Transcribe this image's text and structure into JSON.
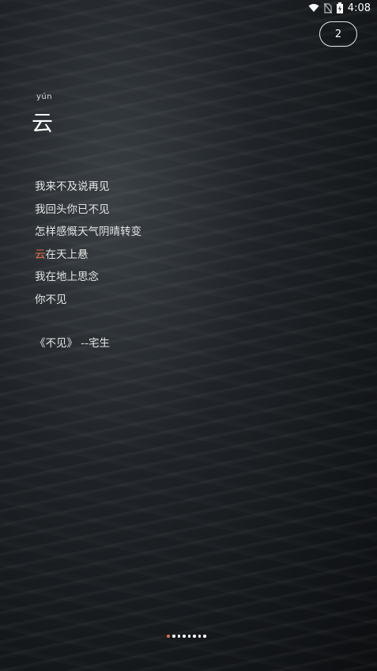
{
  "status_bar": {
    "time": "4:08",
    "icons": [
      "wifi-icon",
      "no-sim-icon",
      "battery-charging-icon"
    ]
  },
  "page_counter": "2",
  "word": {
    "pinyin": "yún",
    "character": "云"
  },
  "poem": {
    "lines": [
      {
        "highlight": "",
        "rest": "我来不及说再见"
      },
      {
        "highlight": "",
        "rest": "我回头你已不见"
      },
      {
        "highlight": "",
        "rest": "怎样感慨天气阴晴转变"
      },
      {
        "highlight": "云",
        "rest": "在天上悬"
      },
      {
        "highlight": "",
        "rest": "我在地上思念"
      },
      {
        "highlight": "",
        "rest": "你不见"
      }
    ],
    "source": "《不见》 --宅生"
  },
  "colors": {
    "accent": "#e0724a",
    "text": "#e4e4e4"
  },
  "pagination": {
    "total": 8,
    "active_index": 0
  }
}
